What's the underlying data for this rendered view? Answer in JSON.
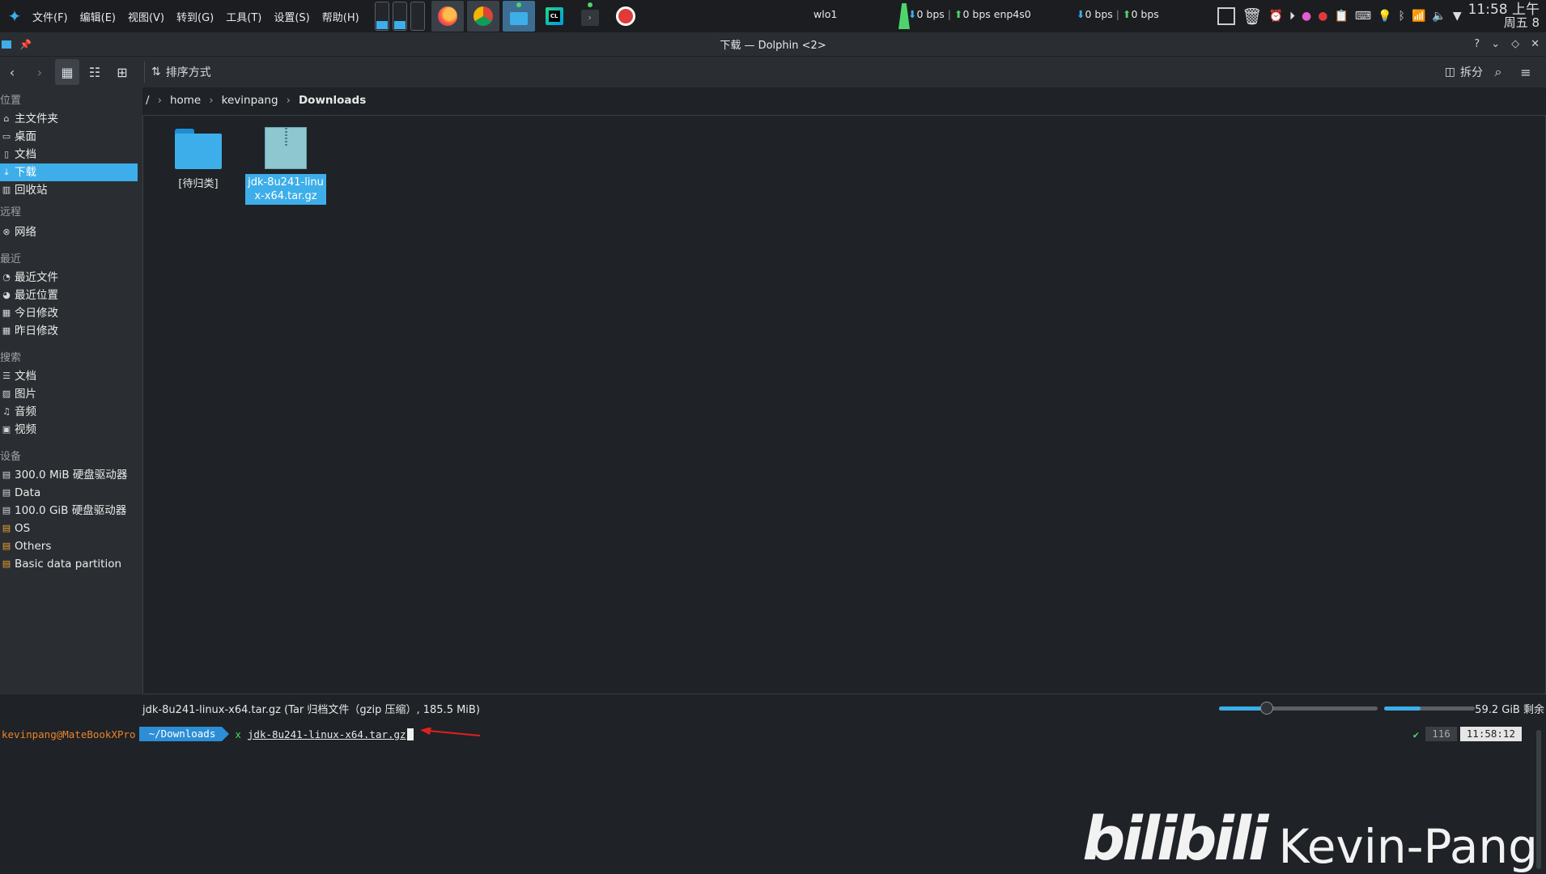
{
  "panel": {
    "menu": [
      "文件(F)",
      "编辑(E)",
      "视图(V)",
      "转到(G)",
      "工具(T)",
      "设置(S)",
      "帮助(H)"
    ],
    "pager_fill": [
      0.3,
      0.3,
      0.0
    ],
    "network": {
      "iface1": "wlo1",
      "iface1_down": "0 bps",
      "iface1_up": "0 bps",
      "iface2": "enp4s0",
      "iface2_down": "0 bps",
      "iface2_up": "0 bps"
    },
    "clock": {
      "time": "11:58 上午",
      "date": "周五 8"
    }
  },
  "window": {
    "title": "下载 — Dolphin <2>",
    "toolbar": {
      "sort_label": "排序方式",
      "split_label": "拆分"
    },
    "breadcrumb": [
      "/",
      "home",
      "kevinpang",
      "Downloads"
    ],
    "sidebar": {
      "sections": [
        {
          "title": "位置",
          "items": [
            {
              "label": "主文件夹",
              "icon": "home-icon"
            },
            {
              "label": "桌面",
              "icon": "desktop-icon"
            },
            {
              "label": "文档",
              "icon": "document-icon"
            },
            {
              "label": "下载",
              "icon": "download-icon",
              "selected": true
            },
            {
              "label": "回收站",
              "icon": "trash-icon"
            }
          ]
        },
        {
          "title": "远程",
          "items": [
            {
              "label": "网络",
              "icon": "network-icon"
            }
          ]
        },
        {
          "title": "最近",
          "items": [
            {
              "label": "最近文件",
              "icon": "recent-files-icon"
            },
            {
              "label": "最近位置",
              "icon": "recent-locations-icon"
            },
            {
              "label": "今日修改",
              "icon": "calendar-icon"
            },
            {
              "label": "昨日修改",
              "icon": "calendar-icon"
            }
          ]
        },
        {
          "title": "搜索",
          "items": [
            {
              "label": "文档",
              "icon": "text-icon"
            },
            {
              "label": "图片",
              "icon": "image-icon"
            },
            {
              "label": "音频",
              "icon": "music-icon"
            },
            {
              "label": "视频",
              "icon": "video-icon"
            }
          ]
        },
        {
          "title": "设备",
          "items": [
            {
              "label": "300.0 MiB 硬盘驱动器",
              "icon": "drive-icon"
            },
            {
              "label": "Data",
              "icon": "drive-icon"
            },
            {
              "label": "100.0 GiB 硬盘驱动器",
              "icon": "drive-icon"
            },
            {
              "label": "OS",
              "icon": "drive-locked-icon"
            },
            {
              "label": "Others",
              "icon": "drive-locked-icon"
            },
            {
              "label": "Basic data partition",
              "icon": "drive-locked-icon"
            }
          ]
        }
      ]
    },
    "files": [
      {
        "name": "[待归类]",
        "type": "folder"
      },
      {
        "name": "jdk-8u241-linux-x64.tar.gz",
        "type": "archive",
        "selected": true
      }
    ],
    "status": {
      "text": "jdk-8u241-linux-x64.tar.gz (Tar 归档文件（gzip 压缩）, 185.5 MiB)",
      "zoom_fraction": 0.3,
      "disk_used_fraction": 0.4,
      "free": "59.2 GiB 剩余"
    }
  },
  "terminal": {
    "user": "kevinpang@MateBookXPro",
    "dir": "~/Downloads",
    "cmd_prefix": "x",
    "command": "jdk-8u241-linux-x64.tar.gz",
    "status_check": "✔",
    "history_num": "116",
    "time": "11:58:12"
  },
  "watermark": {
    "brand": "bilibili",
    "author": "Kevin-Pang"
  },
  "colors": {
    "accent": "#3daee9",
    "prompt_user": "#e8842a",
    "arrow": "#e02020"
  }
}
